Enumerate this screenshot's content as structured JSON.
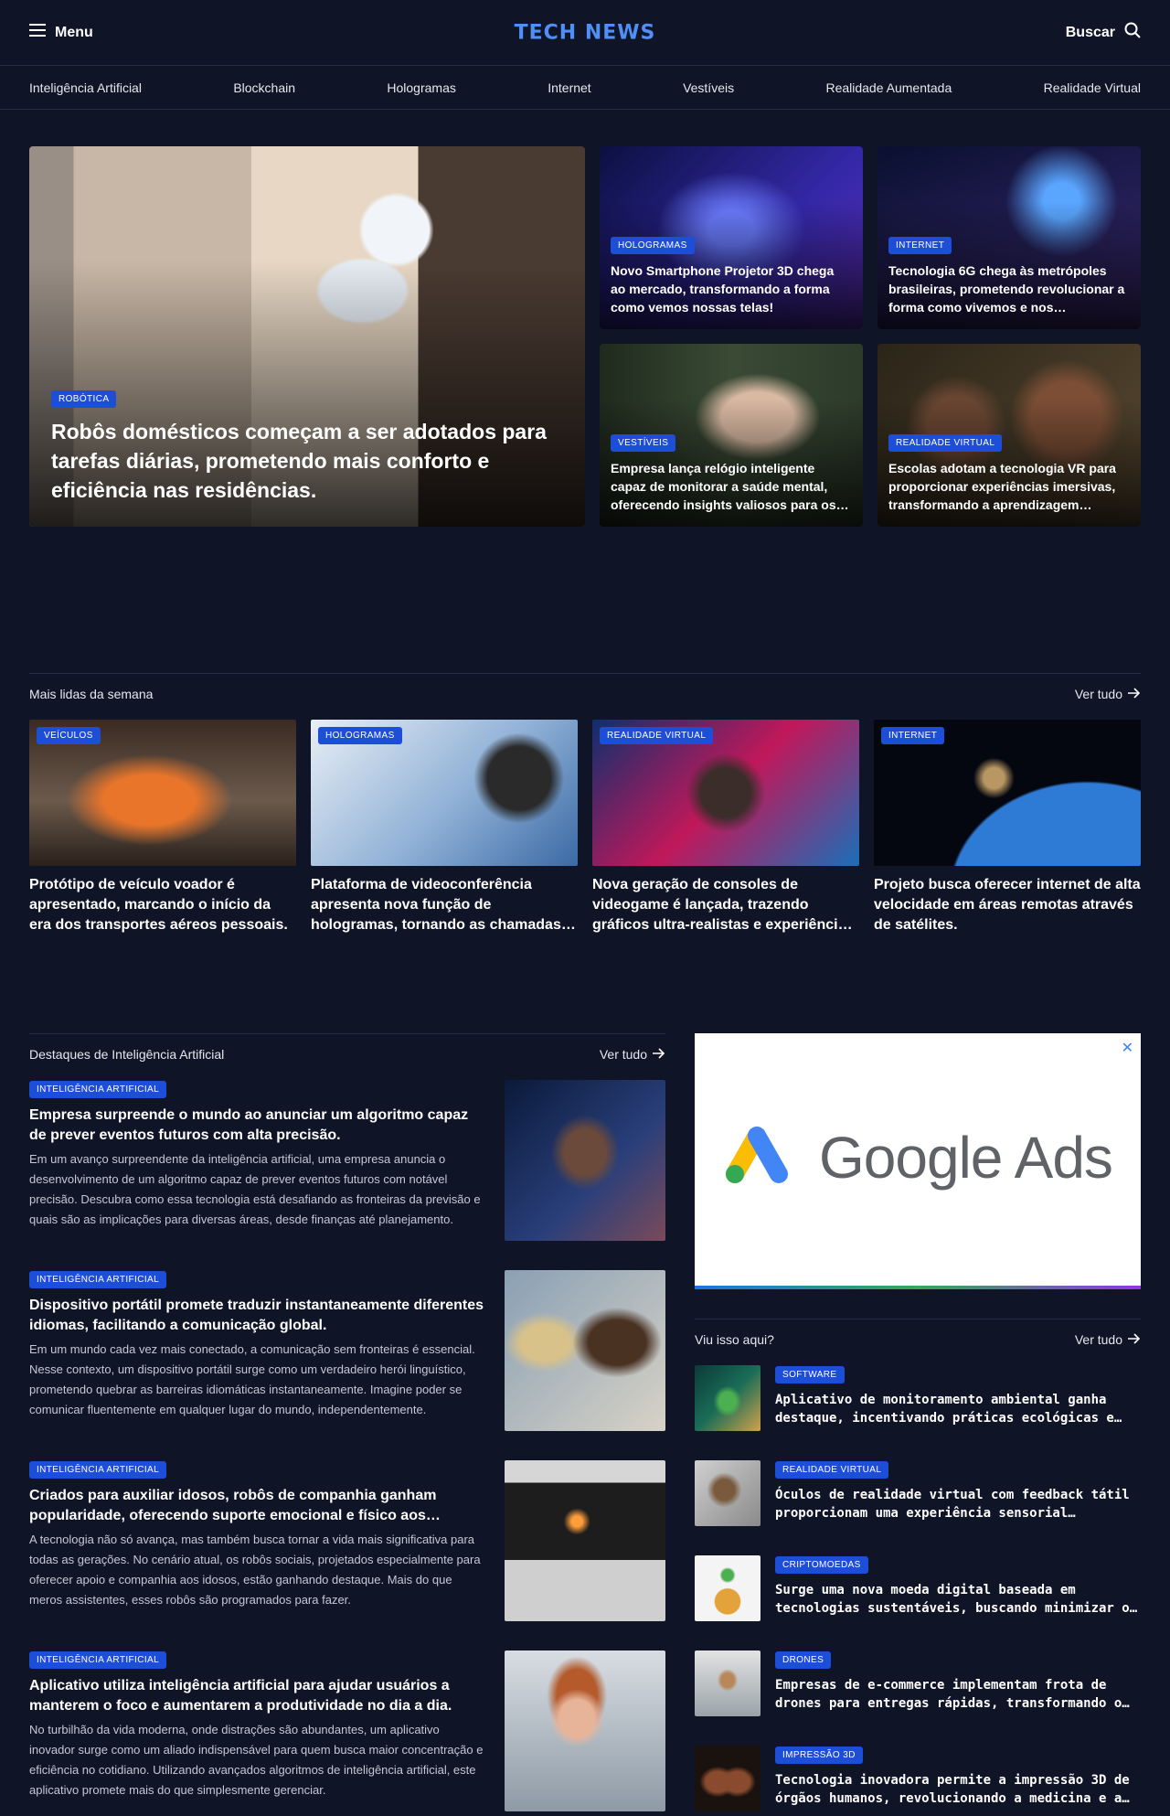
{
  "header": {
    "menu_label": "Menu",
    "menu_icon": "menu-icon",
    "logo": "TECH NEWS",
    "search_label": "Buscar",
    "search_icon": "search-icon"
  },
  "categories": [
    "Inteligência Artificial",
    "Blockchain",
    "Hologramas",
    "Internet",
    "Vestíveis",
    "Realidade Aumentada",
    "Realidade Virtual"
  ],
  "hero": {
    "main": {
      "tag": "ROBÓTICA",
      "title": "Robôs domésticos começam a ser adotados para tarefas diárias, prometendo mais conforto e eficiência nas residências."
    },
    "side": [
      {
        "tag": "HOLOGRAMAS",
        "title": "Novo Smartphone Projetor 3D chega ao mercado, transformando a forma como vemos nossas telas!"
      },
      {
        "tag": "INTERNET",
        "title": "Tecnologia 6G chega às metrópoles brasileiras, prometendo revolucionar a forma como vivemos e nos comunicamos."
      },
      {
        "tag": "VESTÍVEIS",
        "title": "Empresa lança relógio inteligente capaz de monitorar a saúde mental, oferecendo insights valiosos para os usuários."
      },
      {
        "tag": "REALIDADE VIRTUAL",
        "title": "Escolas adotam a tecnologia VR para proporcionar experiências imersivas, transformando a aprendizagem tradicional."
      }
    ]
  },
  "most_read": {
    "title": "Mais lidas da semana",
    "more": "Ver tudo",
    "items": [
      {
        "tag": "VEÍCULOS",
        "title": "Protótipo de veículo voador é apresentado, marcando o início da era dos transportes aéreos pessoais."
      },
      {
        "tag": "HOLOGRAMAS",
        "title": "Plataforma de videoconferência apresenta nova função de hologramas, tornando as chamadas mais imersivas."
      },
      {
        "tag": "REALIDADE VIRTUAL",
        "title": "Nova geração de consoles de videogame é lançada, trazendo gráficos ultra-realistas e experiências imersivas."
      },
      {
        "tag": "INTERNET",
        "title": "Projeto busca oferecer internet de alta velocidade em áreas remotas através de satélites."
      }
    ]
  },
  "ai_highlights": {
    "title": "Destaques de Inteligência Artificial",
    "more": "Ver tudo",
    "items": [
      {
        "tag": "INTELIGÊNCIA ARTIFICIAL",
        "title": "Empresa surpreende o mundo ao anunciar um algoritmo capaz de prever eventos futuros com alta precisão.",
        "excerpt": "Em um avanço surpreendente da inteligência artificial, uma empresa anuncia o desenvolvimento de um algoritmo capaz de prever eventos futuros com notável precisão. Descubra como essa tecnologia está desafiando as fronteiras da previsão e quais são as implicações para diversas áreas, desde finanças até planejamento."
      },
      {
        "tag": "INTELIGÊNCIA ARTIFICIAL",
        "title": "Dispositivo portátil promete traduzir instantaneamente diferentes idiomas, facilitando a comunicação global.",
        "excerpt": "Em um mundo cada vez mais conectado, a comunicação sem fronteiras é essencial. Nesse contexto, um dispositivo portátil surge como um verdadeiro herói linguístico, prometendo quebrar as barreiras idiomáticas instantaneamente. Imagine poder se comunicar fluentemente em qualquer lugar do mundo, independentemente."
      },
      {
        "tag": "INTELIGÊNCIA ARTIFICIAL",
        "title": "Criados para auxiliar idosos, robôs de companhia ganham popularidade, oferecendo suporte emocional e físico aos usuários.",
        "excerpt": "A tecnologia não só avança, mas também busca tornar a vida mais significativa para todas as gerações. No cenário atual, os robôs sociais, projetados especialmente para oferecer apoio e companhia aos idosos, estão ganhando destaque. Mais do que meros assistentes, esses robôs são programados para fazer."
      },
      {
        "tag": "INTELIGÊNCIA ARTIFICIAL",
        "title": "Aplicativo utiliza inteligência artificial para ajudar usuários a manterem o foco e aumentarem a produtividade no dia a dia.",
        "excerpt": "No turbilhão da vida moderna, onde distrações são abundantes, um aplicativo inovador surge como um aliado indispensável para quem busca maior concentração e eficiência no cotidiano. Utilizando avançados algoritmos de inteligência artificial, este aplicativo promete mais do que simplesmente gerenciar."
      }
    ]
  },
  "ad": {
    "brand": "Google Ads",
    "close_icon": "close-icon"
  },
  "seen_here": {
    "title": "Viu isso aqui?",
    "more": "Ver tudo",
    "items": [
      {
        "tag": "SOFTWARE",
        "title": "Aplicativo de monitoramento ambiental ganha destaque, incentivando práticas ecológicas e promovendo a sustentabilidade."
      },
      {
        "tag": "REALIDADE VIRTUAL",
        "title": "Óculos de realidade virtual com feedback tátil proporcionam uma experiência sensorial completa."
      },
      {
        "tag": "CRIPTOMOEDAS",
        "title": "Surge uma nova moeda digital baseada em tecnologias sustentáveis, buscando minimizar o impacto ambiental."
      },
      {
        "tag": "DRONES",
        "title": "Empresas de e-commerce implementam frota de drones para entregas rápidas, transformando o cenário logístico."
      },
      {
        "tag": "IMPRESSÃO 3D",
        "title": "Tecnologia inovadora permite a impressão 3D de órgãos humanos, revolucionando a medicina e a lista de transplantes."
      }
    ]
  },
  "colors": {
    "background": "#0f1427",
    "accent": "#4f8ff7",
    "badge": "#1d4ed8"
  }
}
